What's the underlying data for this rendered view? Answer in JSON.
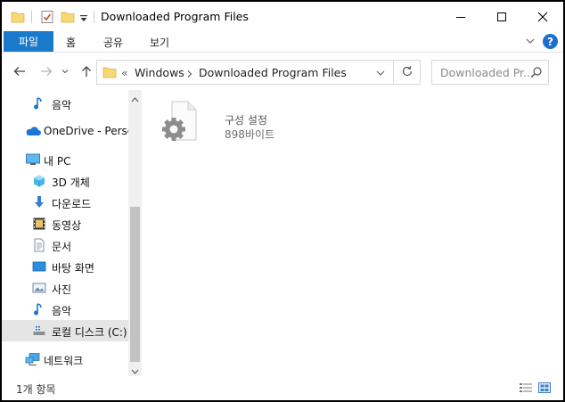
{
  "window": {
    "title": "Downloaded Program Files"
  },
  "ribbon": {
    "tabs": [
      "파일",
      "홈",
      "공유",
      "보기"
    ],
    "help_label": "?"
  },
  "navigation": {
    "breadcrumb_overflow": "«",
    "breadcrumb": [
      "Windows",
      "Downloaded Program Files"
    ],
    "search_placeholder": "Downloaded Pr..."
  },
  "sidebar": {
    "items": [
      {
        "label": "음악",
        "icon": "music-note-icon"
      },
      {
        "label": "OneDrive - Personal",
        "icon": "onedrive-cloud-icon"
      },
      {
        "label": "내 PC",
        "icon": "this-pc-icon"
      },
      {
        "label": "3D 개체",
        "icon": "3d-objects-icon"
      },
      {
        "label": "다운로드",
        "icon": "download-arrow-icon"
      },
      {
        "label": "동영상",
        "icon": "video-film-icon"
      },
      {
        "label": "문서",
        "icon": "document-icon"
      },
      {
        "label": "바탕 화면",
        "icon": "desktop-icon"
      },
      {
        "label": "사진",
        "icon": "pictures-icon"
      },
      {
        "label": "음악",
        "icon": "music-note-icon"
      },
      {
        "label": "로컬 디스크 (C:)",
        "icon": "local-disk-icon",
        "selected": true
      },
      {
        "label": "네트워크",
        "icon": "network-icon"
      }
    ]
  },
  "content": {
    "files": [
      {
        "name": "구성 설정",
        "size": "898바이트",
        "icon": "config-settings-file-icon"
      }
    ]
  },
  "status": {
    "item_count": "1개 항목"
  },
  "colors": {
    "accent": "#1979ca",
    "selection": "#e5e5e5",
    "folder": "#f8d775"
  }
}
